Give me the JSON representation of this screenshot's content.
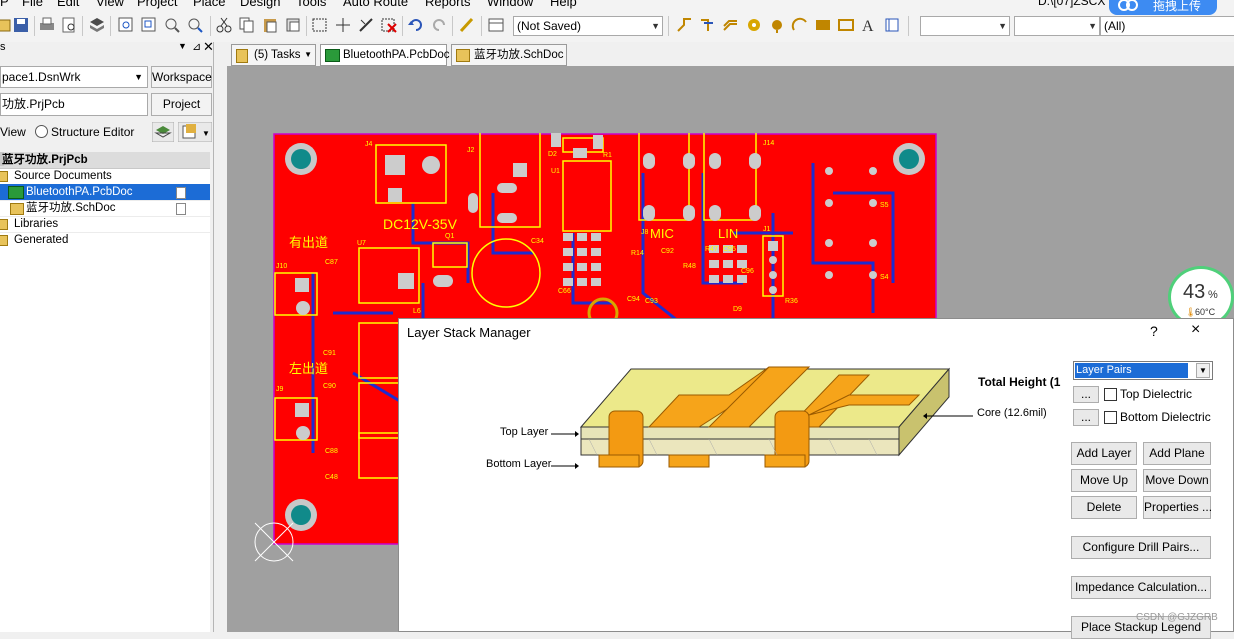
{
  "menu": [
    "P",
    "File",
    "Edit",
    "View",
    "Project",
    "Place",
    "Design",
    "Tools",
    "Auto Route",
    "Reports",
    "Window",
    "Help"
  ],
  "toolbar": {
    "save_state": "(Not Saved)",
    "filter_all": "(All)",
    "path_fragment": "D:\\[07]ZSCX",
    "upload_label": "拖拽上传"
  },
  "panel": {
    "title": "s",
    "workspace_value": "pace1.DsnWrk",
    "workspace_button": "Workspace",
    "project_value": "功放.PrjPcb",
    "project_button": "Project",
    "view_label": "View",
    "structure_label": "Structure Editor",
    "tree": [
      {
        "label": "蓝牙功放.PrjPcb"
      },
      {
        "label": "Source Documents"
      },
      {
        "label": "BluetoothPA.PcbDoc"
      },
      {
        "label": "蓝牙功放.SchDoc"
      },
      {
        "label": "Libraries"
      },
      {
        "label": "Generated"
      }
    ]
  },
  "tabs": [
    {
      "label": "(5) Tasks"
    },
    {
      "label": "BluetoothPA.PcbDoc"
    },
    {
      "label": "蓝牙功放.SchDoc"
    }
  ],
  "pcb": {
    "labels": [
      "J4",
      "J2",
      "D2",
      "R1",
      "U1",
      "DC12V-35V",
      "C34",
      "Q1",
      "有出道",
      "U7",
      "J10",
      "C87",
      "MIC",
      "LIN",
      "J8",
      "J14",
      "J1",
      "S5",
      "S4",
      "R14",
      "C92",
      "R48",
      "R47",
      "C95",
      "C96",
      "R36",
      "D9",
      "C94",
      "C93",
      "C66",
      "L6",
      "C91",
      "C90",
      "左出道",
      "J9",
      "C48",
      "C88"
    ],
    "cpu_percent": "43",
    "cpu_unit": "%",
    "cpu_temp": "60°C"
  },
  "dialog": {
    "title": "Layer Stack Manager",
    "help": "?",
    "close": "×",
    "total_height": "Total Height (1",
    "top_layer": "Top Layer",
    "bottom_layer": "Bottom Layer",
    "core": "Core (12.6mil)",
    "preset_select": "Layer Pairs",
    "dots": "...",
    "top_dielectric": "Top Dielectric",
    "bottom_dielectric": "Bottom Dielectric",
    "add_layer": "Add Layer",
    "add_plane": "Add Plane",
    "move_up": "Move Up",
    "move_down": "Move Down",
    "delete": "Delete",
    "properties": "Properties ...",
    "configure_drill": "Configure Drill Pairs...",
    "impedance": "Impedance Calculation...",
    "place_legend": "Place Stackup Legend"
  },
  "watermark": "CSDN @GJZGRB"
}
